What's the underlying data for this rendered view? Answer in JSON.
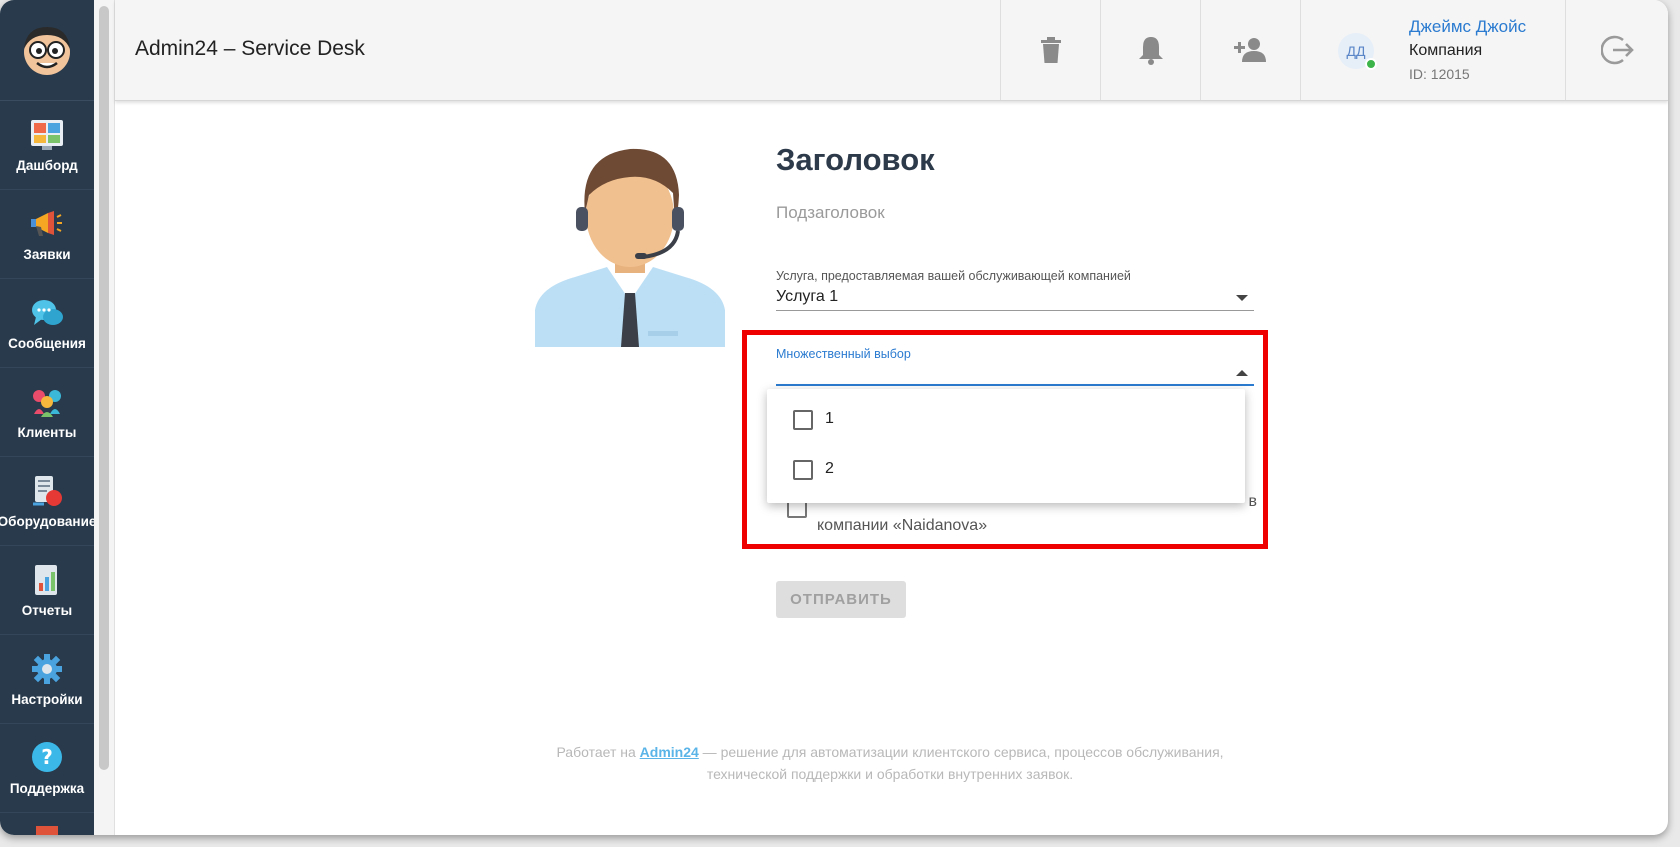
{
  "header": {
    "app_title": "Admin24 – Service Desk",
    "trash_icon": "trash-icon",
    "bell_icon": "bell-icon",
    "add_user_icon": "add-user-icon",
    "logout_icon": "logout-icon"
  },
  "user": {
    "initials": "ДД",
    "name": "Джеймс Джойс",
    "company": "Компания",
    "id_label": "ID: 12015"
  },
  "sidebar": {
    "items": [
      {
        "label": "Дашборд",
        "icon": "dashboard-icon"
      },
      {
        "label": "Заявки",
        "icon": "megaphone-icon"
      },
      {
        "label": "Сообщения",
        "icon": "chat-bubbles-icon"
      },
      {
        "label": "Клиенты",
        "icon": "clients-icon"
      },
      {
        "label": "Оборудование",
        "icon": "equipment-icon"
      },
      {
        "label": "Отчеты",
        "icon": "reports-icon"
      },
      {
        "label": "Настройки",
        "icon": "gear-icon"
      },
      {
        "label": "Поддержка",
        "icon": "help-icon"
      }
    ]
  },
  "form": {
    "title": "Заголовок",
    "subtitle": "Подзаголовок",
    "service_label": "Услуга, предоставляемая вашей обслуживающей компанией",
    "service_value": "Услуга 1",
    "multi_label": "Множественный выбор",
    "options": [
      {
        "label": "1",
        "checked": false
      },
      {
        "label": "2",
        "checked": false
      }
    ],
    "consent_text_tail": "в",
    "consent_text_line2": "компании «Naidanova»",
    "submit_label": "ОТПРАВИТЬ"
  },
  "footer": {
    "prefix": "Работает на ",
    "link": "Admin24",
    "suffix": " — решение для автоматизации клиентского сервиса, процессов обслуживания, технической поддержки и обработки внутренних заявок."
  },
  "colors": {
    "sidebar_bg": "#283a4c",
    "accent_blue": "#2b7bd0",
    "highlight_red": "#ee0000"
  }
}
